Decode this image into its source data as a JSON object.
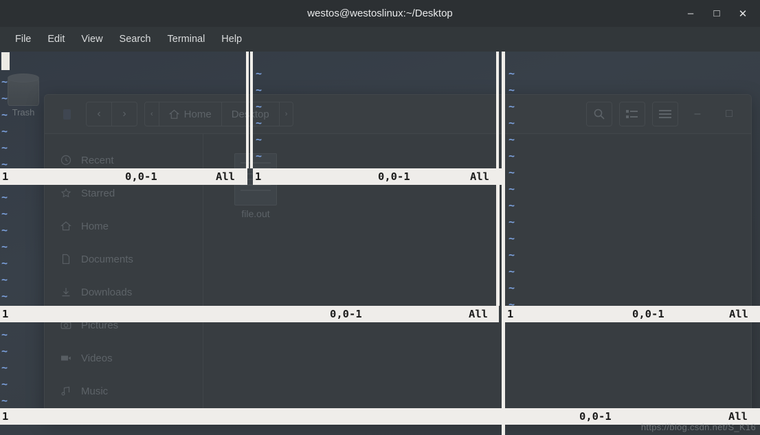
{
  "window": {
    "title": "westos@westoslinux:~/Desktop",
    "controls": [
      {
        "name": "minimize",
        "glyph": "–"
      },
      {
        "name": "maximize",
        "glyph": "□"
      },
      {
        "name": "close",
        "glyph": "✕"
      }
    ]
  },
  "menubar": {
    "items": [
      "File",
      "Edit",
      "View",
      "Search",
      "Terminal",
      "Help"
    ]
  },
  "vim": {
    "tilde": "~",
    "statuslines": [
      {
        "id": "pane-top-left",
        "left": "1",
        "mid": "0,0-1",
        "right": "All"
      },
      {
        "id": "pane-top-mid",
        "left": "1",
        "mid": "0,0-1",
        "right": "All"
      },
      {
        "id": "pane-mid-left",
        "left": "1",
        "mid": "0,0-1",
        "right": "All"
      },
      {
        "id": "pane-mid-right",
        "left": "1",
        "mid": "0,0-1",
        "right": "All"
      },
      {
        "id": "pane-bottom",
        "left": "1",
        "mid": "0,0-1",
        "right": "All"
      }
    ]
  },
  "desktop": {
    "icons": [
      {
        "label": "Trash",
        "type": "trash"
      },
      {
        "label": "file.out",
        "type": "document"
      }
    ]
  },
  "file_manager": {
    "toolbar": {
      "sidebar_toggle": "■",
      "back": "‹",
      "forward": "›",
      "crumb_prev": "‹",
      "home_label": "Home",
      "desktop_label": "Desktop",
      "crumb_next": "›",
      "search": "search-icon",
      "view_list": "list-view-icon",
      "menu": "hamburger-menu-icon",
      "minimize": "–",
      "maximize": "□"
    },
    "sidebar": [
      {
        "label": "Recent",
        "icon": "clock-icon"
      },
      {
        "label": "Starred",
        "icon": "star-icon"
      },
      {
        "label": "Home",
        "icon": "home-icon"
      },
      {
        "label": "Documents",
        "icon": "document-icon"
      },
      {
        "label": "Downloads",
        "icon": "download-icon"
      },
      {
        "label": "Pictures",
        "icon": "camera-icon"
      },
      {
        "label": "Videos",
        "icon": "video-icon"
      },
      {
        "label": "Music",
        "icon": "music-icon"
      }
    ],
    "files": [
      {
        "label": "file.out"
      }
    ]
  },
  "watermark": "https://blog.csdn.net/S_K16",
  "colors": {
    "terminal_bg": "#3b4043",
    "titlebar_bg": "#2c3033",
    "menubar_bg": "#32373a",
    "status_bg": "#efedea",
    "tilde_blue": "#7ba0dc",
    "separator": "#f0eeea"
  }
}
